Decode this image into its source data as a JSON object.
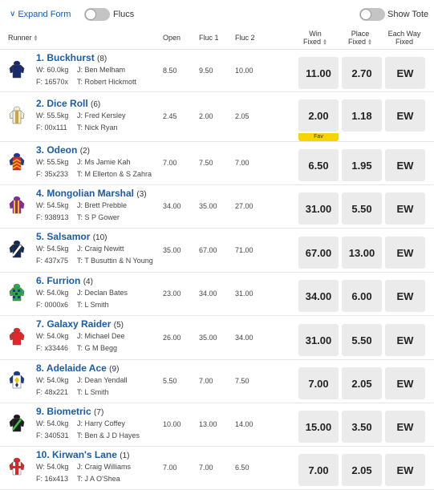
{
  "toolbar": {
    "expand_label": "Expand Form",
    "flucs_label": "Flucs",
    "show_tote_label": "Show Tote"
  },
  "columns": {
    "runner": "Runner",
    "open": "Open",
    "fluc1": "Fluc 1",
    "fluc2": "Fluc 2",
    "win_l1": "Win",
    "win_l2": "Fixed",
    "place_l1": "Place",
    "place_l2": "Fixed",
    "ew_l1": "Each Way",
    "ew_l2": "Fixed"
  },
  "runners": [
    {
      "name": "1. Buckhurst",
      "barrier": "(8)",
      "weight": "W: 60.0kg",
      "jockey": "J: Ben Melham",
      "form": "F: 16570x",
      "trainer": "T: Robert Hickmott",
      "open": "8.50",
      "fluc1": "9.50",
      "fluc2": "10.00",
      "win": "11.00",
      "place": "2.70",
      "ew": "EW",
      "fav": ""
    },
    {
      "name": "2. Dice Roll",
      "barrier": "(6)",
      "weight": "W: 55.5kg",
      "jockey": "J: Fred Kersley",
      "form": "F: 00x111",
      "trainer": "T: Nick Ryan",
      "open": "2.45",
      "fluc1": "2.00",
      "fluc2": "2.05",
      "win": "2.00",
      "place": "1.18",
      "ew": "EW",
      "fav": "Fav"
    },
    {
      "name": "3. Odeon",
      "barrier": "(2)",
      "weight": "W: 55.5kg",
      "jockey": "J: Ms Jamie Kah",
      "form": "F: 35x233",
      "trainer": "T: M Ellerton & S Zahra",
      "open": "7.00",
      "fluc1": "7.50",
      "fluc2": "7.00",
      "win": "6.50",
      "place": "1.95",
      "ew": "EW",
      "fav": ""
    },
    {
      "name": "4. Mongolian Marshal",
      "barrier": "(3)",
      "weight": "W: 54.5kg",
      "jockey": "J: Brett Prebble",
      "form": "F: 938913",
      "trainer": "T: S P Gower",
      "open": "34.00",
      "fluc1": "35.00",
      "fluc2": "27.00",
      "win": "31.00",
      "place": "5.50",
      "ew": "EW",
      "fav": ""
    },
    {
      "name": "5. Salsamor",
      "barrier": "(10)",
      "weight": "W: 54.5kg",
      "jockey": "J: Craig Newitt",
      "form": "F: 437x75",
      "trainer": "T: T Busuttin & N Young",
      "open": "35.00",
      "fluc1": "67.00",
      "fluc2": "71.00",
      "win": "67.00",
      "place": "13.00",
      "ew": "EW",
      "fav": ""
    },
    {
      "name": "6. Furrion",
      "barrier": "(4)",
      "weight": "W: 54.0kg",
      "jockey": "J: Declan Bates",
      "form": "F: 0000x6",
      "trainer": "T: L Smith",
      "open": "23.00",
      "fluc1": "34.00",
      "fluc2": "31.00",
      "win": "34.00",
      "place": "6.00",
      "ew": "EW",
      "fav": ""
    },
    {
      "name": "7. Galaxy Raider",
      "barrier": "(5)",
      "weight": "W: 54.0kg",
      "jockey": "J: Michael Dee",
      "form": "F: x33446",
      "trainer": "T: G M Begg",
      "open": "26.00",
      "fluc1": "35.00",
      "fluc2": "34.00",
      "win": "31.00",
      "place": "5.50",
      "ew": "EW",
      "fav": ""
    },
    {
      "name": "8. Adelaide Ace",
      "barrier": "(9)",
      "weight": "W: 54.0kg",
      "jockey": "J: Dean Yendall",
      "form": "F: 48x221",
      "trainer": "T: L Smith",
      "open": "5.50",
      "fluc1": "7.00",
      "fluc2": "7.50",
      "win": "7.00",
      "place": "2.05",
      "ew": "EW",
      "fav": ""
    },
    {
      "name": "9. Biometric",
      "barrier": "(7)",
      "weight": "W: 54.0kg",
      "jockey": "J: Harry Coffey",
      "form": "F: 340531",
      "trainer": "T: Ben & J D Hayes",
      "open": "10.00",
      "fluc1": "13.00",
      "fluc2": "14.00",
      "win": "15.00",
      "place": "3.50",
      "ew": "EW",
      "fav": ""
    },
    {
      "name": "10. Kirwan's Lane",
      "barrier": "(1)",
      "weight": "W: 54.0kg",
      "jockey": "J: Craig Williams",
      "form": "F: 16x413",
      "trainer": "T: J A O'Shea",
      "open": "7.00",
      "fluc1": "7.00",
      "fluc2": "6.50",
      "win": "7.00",
      "place": "2.05",
      "ew": "EW",
      "fav": ""
    }
  ],
  "silks": [
    {
      "body": "#1b2a6b",
      "sleeves": "#1b2a6b",
      "pattern": "solid",
      "accent": "#1b2a6b"
    },
    {
      "body": "#f2ecd8",
      "sleeves": "#f2ecd8",
      "pattern": "stripe",
      "accent": "#c9a640"
    },
    {
      "body": "#d8262a",
      "sleeves": "#1b3a8c",
      "pattern": "chevrons",
      "accent": "#f2c300"
    },
    {
      "body": "#8a2a9a",
      "sleeves": "#8a2a9a",
      "pattern": "vstripes",
      "accent": "#f2c300"
    },
    {
      "body": "#14284f",
      "sleeves": "#14284f",
      "pattern": "sash",
      "accent": "#ffffff"
    },
    {
      "body": "#2ea84a",
      "sleeves": "#2ea84a",
      "pattern": "checks",
      "accent": "#1b3a8c"
    },
    {
      "body": "#e2262a",
      "sleeves": "#e2262a",
      "pattern": "solid",
      "accent": "#e2262a"
    },
    {
      "body": "#ffffff",
      "sleeves": "#1b3a8c",
      "pattern": "diamonds",
      "accent": "#f2c300"
    },
    {
      "body": "#1b1b1b",
      "sleeves": "#1b1b1b",
      "pattern": "sash",
      "accent": "#39c24a"
    },
    {
      "body": "#ffffff",
      "sleeves": "#d8262a",
      "pattern": "cross",
      "accent": "#d8262a"
    }
  ]
}
